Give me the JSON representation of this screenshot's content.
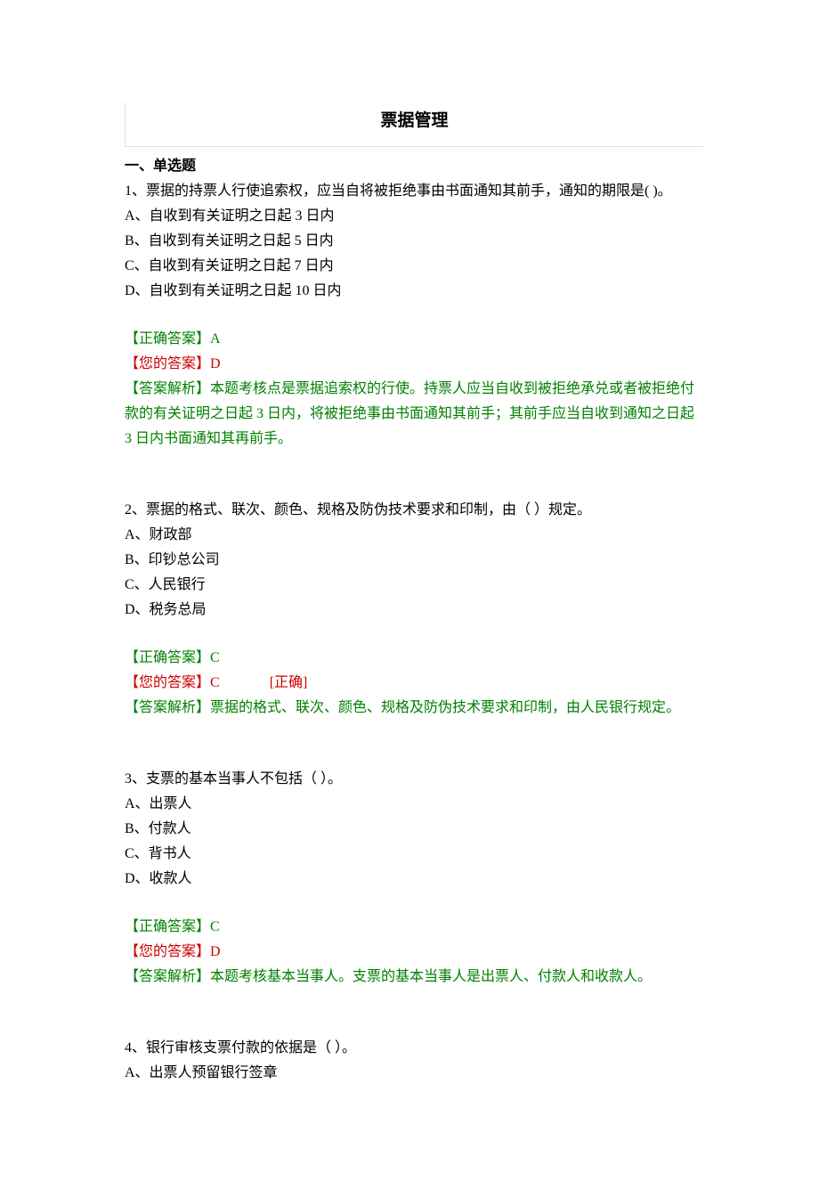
{
  "title": "票据管理",
  "sectionHeading": "一、单选题",
  "labels": {
    "correctAnswer": "【正确答案】",
    "yourAnswer": "【您的答案】",
    "analysis": "【答案解析】",
    "correctTag": "[正确]"
  },
  "q1": {
    "stem": "1、票据的持票人行使追索权，应当自将被拒绝事由书面通知其前手，通知的期限是( )。",
    "optA": "A、自收到有关证明之日起 3 日内",
    "optB": "B、自收到有关证明之日起 5 日内",
    "optC": "C、自收到有关证明之日起 7 日内",
    "optD": "D、自收到有关证明之日起 10 日内",
    "correct": "A",
    "your": "D",
    "analysis": "本题考核点是票据追索权的行使。持票人应当自收到被拒绝承兑或者被拒绝付款的有关证明之日起 3 日内，将被拒绝事由书面通知其前手；其前手应当自收到通知之日起 3 日内书面通知其再前手。"
  },
  "q2": {
    "stem": "2、票据的格式、联次、颜色、规格及防伪技术要求和印制，由（ ）规定。",
    "optA": "A、财政部",
    "optB": "B、印钞总公司",
    "optC": "C、人民银行",
    "optD": "D、税务总局",
    "correct": "C",
    "your": "C",
    "analysis": "票据的格式、联次、颜色、规格及防伪技术要求和印制，由人民银行规定。"
  },
  "q3": {
    "stem": "3、支票的基本当事人不包括（ ）。",
    "optA": "A、出票人",
    "optB": "B、付款人",
    "optC": "C、背书人",
    "optD": "D、收款人",
    "correct": "C",
    "your": "D",
    "analysis": "本题考核基本当事人。支票的基本当事人是出票人、付款人和收款人。"
  },
  "q4": {
    "stem": "4、银行审核支票付款的依据是（ ）。",
    "optA": "A、出票人预留银行签章"
  }
}
